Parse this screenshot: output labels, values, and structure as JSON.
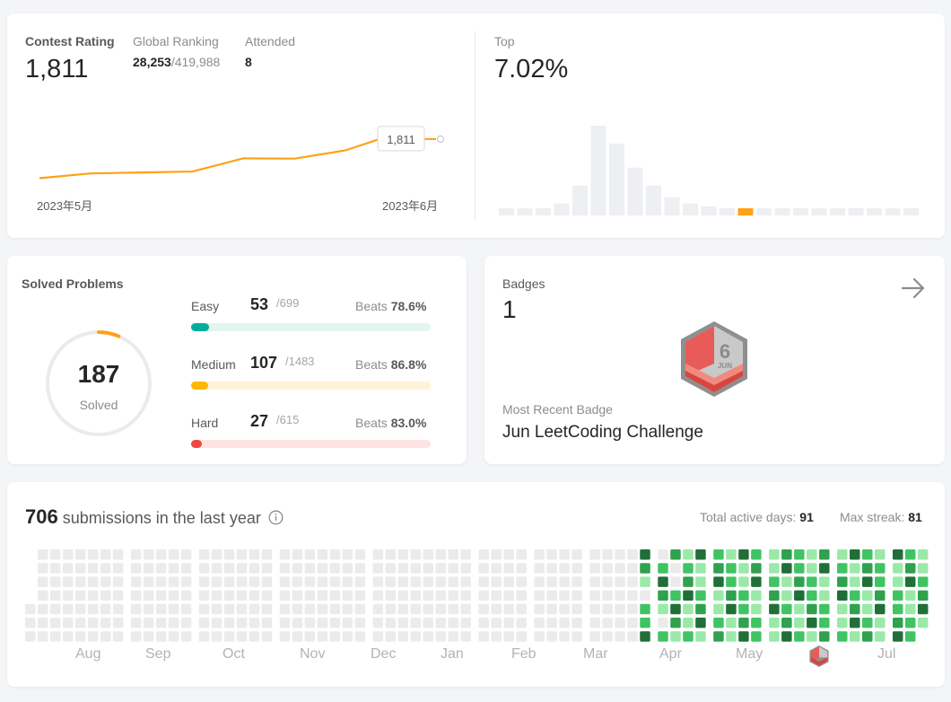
{
  "contest": {
    "rating_label": "Contest Rating",
    "rating_value": "1,811",
    "global_ranking_label": "Global Ranking",
    "global_ranking_value": "28,253",
    "global_ranking_total": "/419,988",
    "attended_label": "Attended",
    "attended_value": "8",
    "tooltip_value": "1,811",
    "x_start_label": "2023年5月",
    "x_end_label": "2023年6月",
    "top_label": "Top",
    "top_value": "7.02%",
    "highlight_color": "#ffa116"
  },
  "chart_data": [
    {
      "type": "line",
      "x": [
        "2023年5月",
        "",
        "",
        "",
        "",
        "",
        "",
        "2023年6月"
      ],
      "values": [
        1565,
        1595,
        1601,
        1607,
        1690,
        1688,
        1740,
        1811
      ],
      "ylim": [
        1500,
        1850
      ],
      "color": "#ffa116"
    },
    {
      "type": "bar",
      "values": [
        1,
        1,
        1,
        2,
        5,
        15,
        12,
        8,
        5,
        3,
        2,
        1.5,
        1,
        1,
        1,
        1,
        1,
        1,
        1,
        1,
        1,
        1,
        1
      ],
      "highlight_index": 13,
      "color": "#eeeff2",
      "highlight_color": "#ffa116"
    }
  ],
  "solved": {
    "title": "Solved Problems",
    "total": "187",
    "total_label": "Solved",
    "total_fraction": 0.064,
    "difficulties": [
      {
        "label": "Easy",
        "count": "53",
        "total": "/699",
        "beats_label": "Beats",
        "beats": "78.6%",
        "fraction": 0.076,
        "color": "#00af9b",
        "track": "#e2f5ee"
      },
      {
        "label": "Medium",
        "count": "107",
        "total": "/1483",
        "beats_label": "Beats",
        "beats": "86.8%",
        "fraction": 0.072,
        "color": "#ffb800",
        "track": "#fdf3d6"
      },
      {
        "label": "Hard",
        "count": "27",
        "total": "/615",
        "beats_label": "Beats",
        "beats": "83.0%",
        "fraction": 0.044,
        "color": "#ef4743",
        "track": "#fde4e3"
      }
    ]
  },
  "badges": {
    "title": "Badges",
    "count": "1",
    "recent_label": "Most Recent Badge",
    "recent_name": "Jun LeetCoding Challenge",
    "badge_number": "6",
    "badge_month": "JUN",
    "arrow_icon": "arrow-right-icon"
  },
  "submissions": {
    "count": "706",
    "label": "submissions in the last year",
    "active_days_label": "Total active days:",
    "active_days": "91",
    "max_streak_label": "Max streak:",
    "max_streak": "81",
    "info_icon": "info-icon",
    "months": [
      "Aug",
      "Sep",
      "Oct",
      "Nov",
      "Dec",
      "Jan",
      "Feb",
      "Mar",
      "Apr",
      "May",
      "Jun",
      "Jul"
    ],
    "colors": {
      "empty": "#ebebeb",
      "l1": "#9be9a8",
      "l2": "#40c463",
      "l3": "#30a14e",
      "l4": "#216e39"
    }
  }
}
